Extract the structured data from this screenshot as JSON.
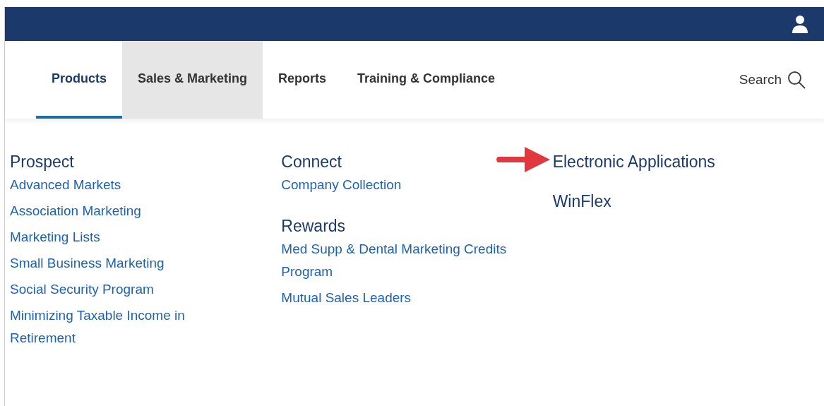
{
  "tabs": [
    {
      "label": "Products",
      "selected": true,
      "highlighted": false
    },
    {
      "label": "Sales & Marketing",
      "selected": false,
      "highlighted": true
    },
    {
      "label": "Reports",
      "selected": false,
      "highlighted": false
    },
    {
      "label": "Training & Compliance",
      "selected": false,
      "highlighted": false
    }
  ],
  "search": {
    "label": "Search"
  },
  "menu": {
    "columns": [
      {
        "sections": [
          {
            "heading": "Prospect",
            "links": [
              "Advanced Markets",
              "Association Marketing",
              "Marketing Lists",
              "Small Business Marketing",
              "Social Security Program",
              "Minimizing Taxable Income in Retirement"
            ]
          }
        ]
      },
      {
        "sections": [
          {
            "heading": "Connect",
            "links": [
              "Company Collection"
            ]
          },
          {
            "heading": "Rewards",
            "links": [
              "Med Supp & Dental Marketing Credits Program",
              "Mutual Sales Leaders"
            ]
          }
        ]
      },
      {
        "sections": [
          {
            "heading": "Electronic Applications",
            "annotated": true
          },
          {
            "heading": "WinFlex",
            "annotated": false
          }
        ]
      }
    ]
  }
}
